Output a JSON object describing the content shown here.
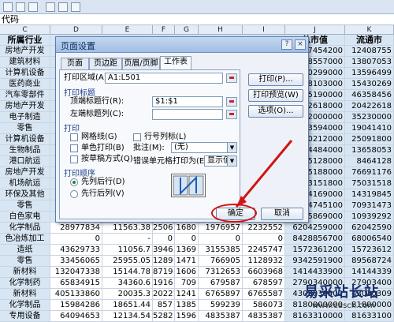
{
  "formula_bar": {
    "text": "代码"
  },
  "columns": [
    "C",
    "D",
    "E",
    "F",
    "G",
    "H",
    "I",
    "J",
    "K"
  ],
  "header_row": {
    "industry": "所属行业",
    "total_value": "总市值",
    "circulating": "流通市"
  },
  "rows": [
    {
      "a": "房地产开发",
      "j": "2487454200",
      "k": "12408755"
    },
    {
      "a": "建筑材料",
      "j": "1998557000",
      "k": "13807053"
    },
    {
      "a": "计算机设备",
      "j": "3550299000",
      "k": "13596499"
    },
    {
      "a": "医药商业",
      "j": "3988103000",
      "k": "15430269"
    },
    {
      "a": "汽车零部件",
      "j": "0695190000",
      "k": "46358456"
    },
    {
      "a": "房地产开发",
      "j": "0422618000",
      "k": "20422618"
    },
    {
      "a": "电子制造",
      "j": "6092000000",
      "k": "35230000"
    },
    {
      "a": "零售",
      "j": "0593594000",
      "k": "19041410"
    },
    {
      "a": "计算机设备",
      "j": "3510212000",
      "k": "25091800"
    },
    {
      "a": "生物制品",
      "j": "4064484000",
      "k": "13658053"
    },
    {
      "a": "港口航运",
      "j": "4065128000",
      "k": "8464128"
    },
    {
      "a": "房地产开发",
      "j": "1875188000",
      "k": "76691176"
    },
    {
      "a": "机场航运",
      "j": "7503151800",
      "k": "75031518"
    },
    {
      "a": "环保及其他",
      "j": "4324169000",
      "k": "14319845"
    },
    {
      "a": "零售",
      "j": "7104745100",
      "k": "70931473"
    },
    {
      "a": "白色家电",
      "j": "5805869000",
      "k": "10939292"
    },
    {
      "a": "化学制品",
      "d": "28977834",
      "e": "11563.38",
      "f": "2506",
      "g": "1680",
      "h": "1976957",
      "i": "2232552",
      "j": "6204259000",
      "k": "62042590"
    },
    {
      "a": "色冶炼加工",
      "d": "0",
      "e": "-",
      "f": "0",
      "g": "0",
      "h": "0",
      "i": "0",
      "j": "8428856700",
      "k": "68006540"
    },
    {
      "a": "造纸",
      "d": "43629733",
      "e": "11056.7",
      "f": "3946",
      "g": "1369",
      "h": "3155385",
      "i": "2245747",
      "j": "1572361200",
      "k": "15723612"
    },
    {
      "a": "零售",
      "d": "33456065",
      "e": "25955.05",
      "f": "1289",
      "g": "1471",
      "h": "766905",
      "i": "1128932",
      "j": "9342591900",
      "k": "89568724"
    },
    {
      "a": "新材料",
      "d": "132047338",
      "e": "15144.78",
      "f": "8719",
      "g": "1606",
      "h": "7312653",
      "i": "6603968",
      "j": "1414433900",
      "k": "14144339"
    },
    {
      "a": "化学制药",
      "d": "65834915",
      "e": "34360.6",
      "f": "1916",
      "g": "709",
      "h": "679587",
      "i": "678597",
      "j": "2790340000",
      "k": "27903400"
    },
    {
      "a": "新材料",
      "d": "405133860",
      "e": "20035.3",
      "f": "20221",
      "g": "1241",
      "h": "6765897",
      "i": "6765587",
      "j": "4303030900",
      "k": "43030309"
    },
    {
      "a": "化学制品",
      "d": "15984286",
      "e": "18651.44",
      "f": "857",
      "g": "1385",
      "h": "599239",
      "i": "586073",
      "j": "8180000000",
      "k": "81800000"
    },
    {
      "a": "专用设备",
      "d": "64094653",
      "e": "12134.54",
      "f": "5282",
      "g": "1596",
      "h": "4835387",
      "i": "4835387",
      "j": "8163310000",
      "k": "81633100"
    }
  ],
  "dialog": {
    "title": "页面设置",
    "help_label": "?",
    "close_label": "×",
    "tabs": [
      "页面",
      "页边距",
      "页眉/页脚",
      "工作表"
    ],
    "print_area_label": "打印区域(A):",
    "print_area_value": "A1:L501",
    "print_titles_section": "打印标题",
    "top_rows_label": "顶端标题行(R):",
    "top_rows_value": "$1:$1",
    "left_cols_label": "左端标题列(C):",
    "left_cols_value": "",
    "print_section": "打印",
    "gridlines_label": "网格线(G)",
    "row_col_headers_label": "行号列标(L)",
    "bw_label": "单色打印(B)",
    "comments_label": "批注(M):",
    "comments_value": "(无)",
    "draft_label": "按草稿方式(Q)",
    "error_label": "错误单元格打印为(E):",
    "error_value": "显示值",
    "order_section": "打印顺序",
    "down_then_over_label": "先列后行(D)",
    "over_then_down_label": "先行后列(V)",
    "print_button": "打印(P)...",
    "preview_button": "打印预览(W)",
    "options_button": "选项(O)...",
    "ok_button": "确定",
    "cancel_button": "取消"
  },
  "watermark": {
    "text": "易采站长站",
    "url": "www.easck.com"
  }
}
